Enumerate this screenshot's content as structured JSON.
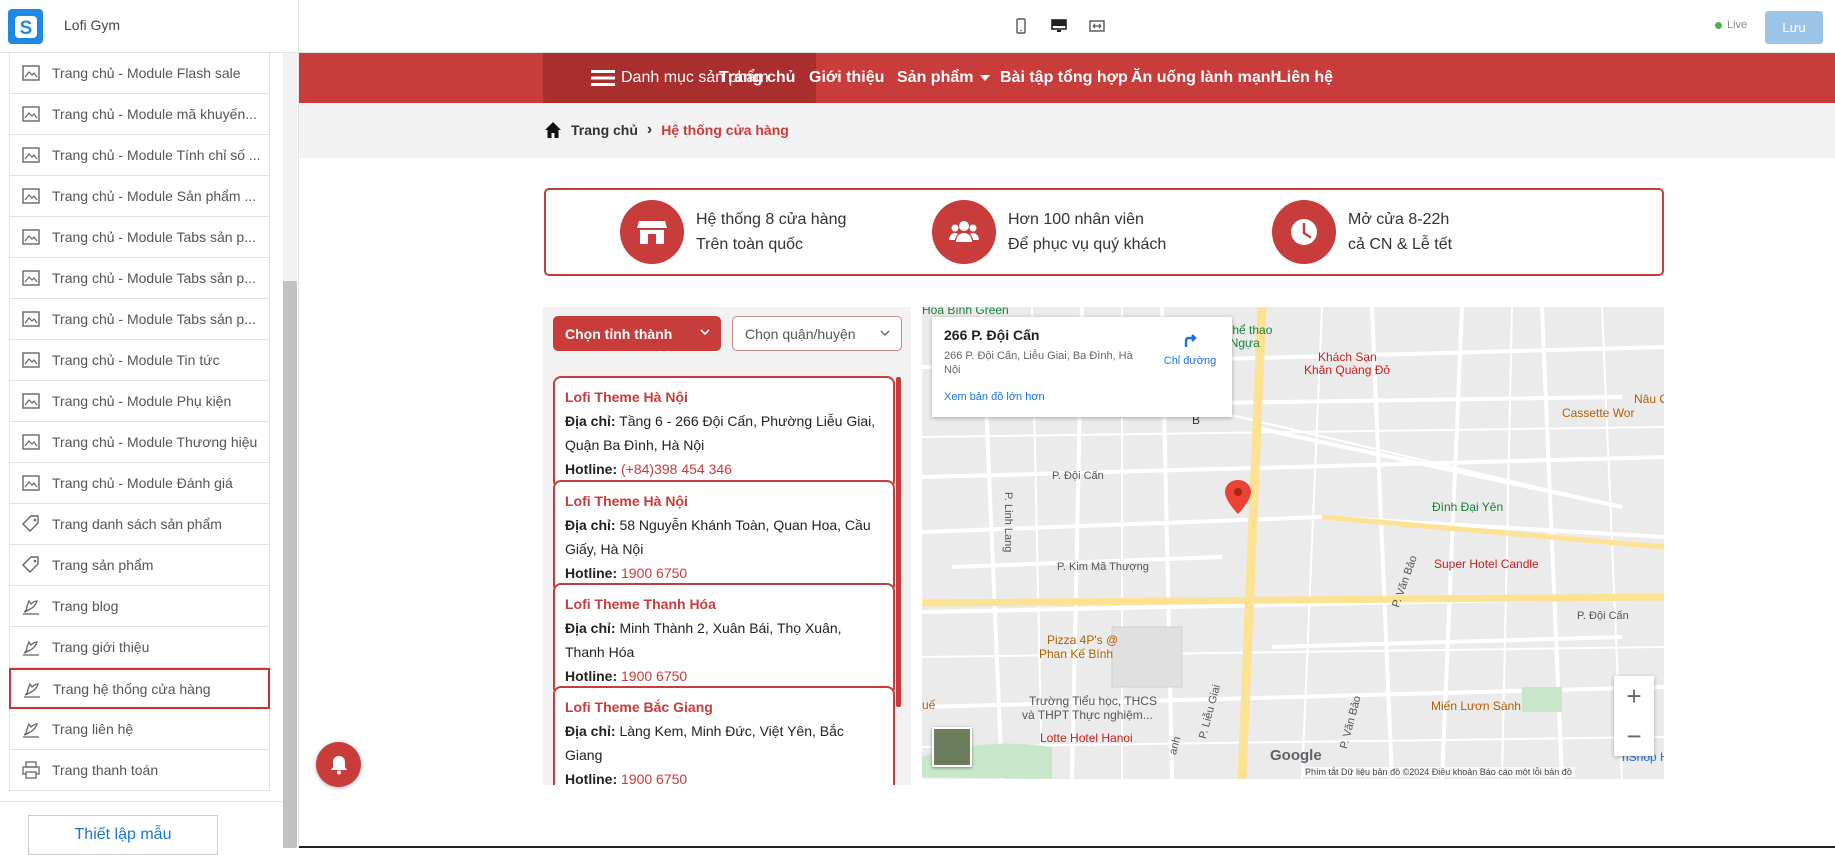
{
  "app": {
    "name": "Lofi Gym",
    "live_label": "Live",
    "save_label": "Lưu"
  },
  "devices": [
    "mobile-icon",
    "desktop-icon",
    "fullwidth-icon"
  ],
  "sidebar": {
    "items": [
      {
        "label": "Trang chủ - Module Flash sale",
        "icon": "layout-icon"
      },
      {
        "label": "Trang chủ - Module mã khuyến...",
        "icon": "layout-icon"
      },
      {
        "label": "Trang chủ - Module Tính chỉ số ...",
        "icon": "layout-icon"
      },
      {
        "label": "Trang chủ - Module Sản phẩm ...",
        "icon": "layout-icon"
      },
      {
        "label": "Trang chủ - Module Tabs sản p...",
        "icon": "layout-icon"
      },
      {
        "label": "Trang chủ - Module Tabs sản p...",
        "icon": "layout-icon"
      },
      {
        "label": "Trang chủ - Module Tabs sản p...",
        "icon": "layout-icon"
      },
      {
        "label": "Trang chủ - Module Tin tức",
        "icon": "layout-icon"
      },
      {
        "label": "Trang chủ - Module Phụ kiện",
        "icon": "layout-icon"
      },
      {
        "label": "Trang chủ - Module Thương hiệu",
        "icon": "layout-icon"
      },
      {
        "label": "Trang chủ - Module Đánh giá",
        "icon": "layout-icon"
      },
      {
        "label": "Trang danh sách sản phẩm",
        "icon": "tag-icon"
      },
      {
        "label": "Trang sản phẩm",
        "icon": "tag-icon"
      },
      {
        "label": "Trang blog",
        "icon": "blog-icon"
      },
      {
        "label": "Trang giới thiệu",
        "icon": "blog-icon"
      },
      {
        "label": "Trang hệ thống cửa hàng",
        "icon": "blog-icon",
        "active": true
      },
      {
        "label": "Trang liên hệ",
        "icon": "blog-icon"
      },
      {
        "label": "Trang thanh toán",
        "icon": "printer-icon"
      }
    ],
    "setup_label": "Thiết lập mẫu"
  },
  "nav": {
    "category_label": "Danh mục sản phẩm",
    "links": [
      "Trang chủ",
      "Giới thiệu",
      "Sản phẩm",
      "Bài tập tổng hợp",
      "Ăn uống lành mạnh",
      "Liên hệ"
    ]
  },
  "breadcrumb": {
    "home": "Trang chủ",
    "separator": "›",
    "current": "Hệ thống cửa hàng"
  },
  "info": [
    {
      "line1": "Hệ thống 8 cửa hàng",
      "line2": "Trên toàn quốc",
      "icon": "store-icon"
    },
    {
      "line1": "Hơn 100 nhân viên",
      "line2": "Để phục vụ quý khách",
      "icon": "users-icon"
    },
    {
      "line1": "Mở cửa 8-22h",
      "line2": "cả CN & Lễ tết",
      "icon": "clock-icon"
    }
  ],
  "filters": {
    "province": "Chọn tỉnh thành",
    "district": "Chọn quận/huyện"
  },
  "stores": [
    {
      "name": "Lofi Theme Hà Nội",
      "addr_label": "Địa chỉ:",
      "addr": "Tầng 6 - 266 Đội Cấn, Phường Liễu Giai, Quận Ba Đình, Hà Nội",
      "hot_label": "Hotline:",
      "hot": "(+84)398 454 346"
    },
    {
      "name": "Lofi Theme Hà Nội",
      "addr_label": "Địa chỉ:",
      "addr": "58 Nguyễn Khánh Toàn, Quan Hoa, Cầu Giấy, Hà Nội",
      "hot_label": "Hotline:",
      "hot": "1900 6750"
    },
    {
      "name": "Lofi Theme Thanh Hóa",
      "addr_label": "Địa chỉ:",
      "addr": "Minh Thành 2, Xuân Bái, Thọ Xuân, Thanh Hóa",
      "hot_label": "Hotline:",
      "hot": "1900 6750"
    },
    {
      "name": "Lofi Theme Bắc Giang",
      "addr_label": "Địa chỉ:",
      "addr": "Làng Kem, Minh Đức, Việt Yên, Bắc Giang",
      "hot_label": "Hotline:",
      "hot": "1900 6750"
    }
  ],
  "map": {
    "place": "266 P. Đội Cấn",
    "address": "266 P. Đội Cấn, Liễu Giai, Ba Đình, Hà Nội",
    "directions": "Chỉ đường",
    "larger": "Xem bản đồ lớn hơn",
    "labels": {
      "hoabinh": "Hòa Bình Green",
      "cung": "Cung thể thao",
      "quanngua": "Quần Ngựa",
      "ks1": "Khách Sạn",
      "ks2": "Khăn Quàng Đỏ",
      "nau": "Nâu C",
      "cassette": "Cassette Wor",
      "doican1": "P. Đội Cấn",
      "linhlang": "P. Linh Lang",
      "kimma": "P. Kim Mã Thượng",
      "dinh": "Đình Đại Yên",
      "candle": "Super Hotel Candle",
      "vanbao": "P. Văn Bảo",
      "doican2": "P. Đội Cấn",
      "pizza1": "Pizza 4P's @",
      "pizza2": "Phan Kế Bính",
      "school1": "Trường Tiểu học, THCS",
      "school2": "và THPT Thực nghiệm...",
      "lieugiai": "P. Liễu Giai",
      "mien": "Miến Lươn Sành",
      "lotte": "Lotte Hotel Hanoi",
      "vanbao2": "P. Văn Bảo",
      "google": "Google",
      "b": "B",
      "hshop": "hShop H",
      "anh": "anh",
      "que": "uế"
    },
    "footer": "Phím tắt   Dữ liệu bản đồ ©2024   Điều khoản   Báo cáo một lỗi bản đồ"
  },
  "colors": {
    "primary": "#c83c3c",
    "primary_dark": "#a92e2e",
    "logo": "#1e88e5",
    "save": "#9cc4e6"
  }
}
